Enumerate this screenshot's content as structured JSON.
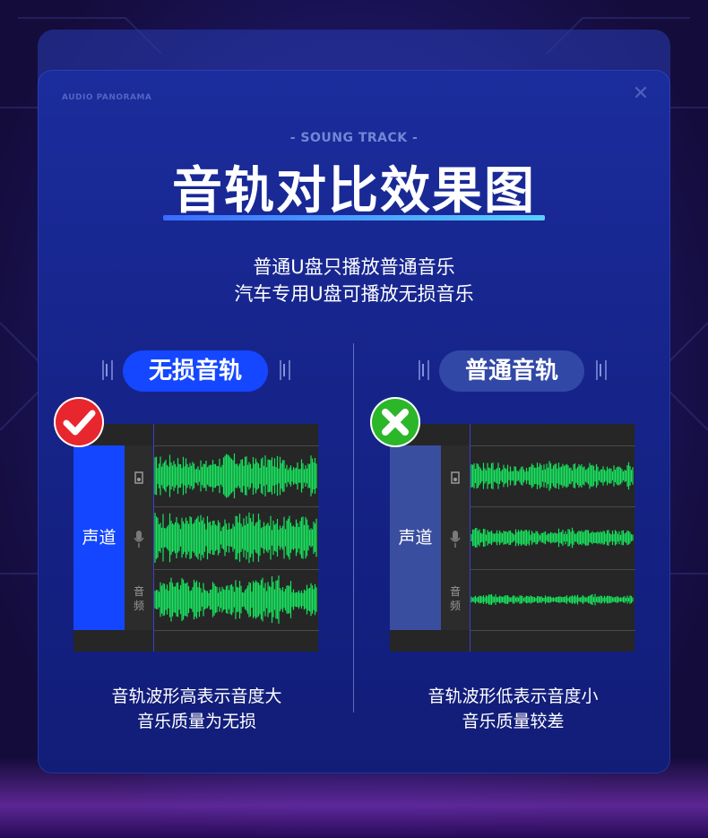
{
  "header": {
    "brand": "AUDIO PANORAMA",
    "subtitle": "- SOUNG TRACK -",
    "title": "音轨对比效果图",
    "desc_line1": "普通U盘只播放普通音乐",
    "desc_line2": "汽车专用U盘可播放无损音乐"
  },
  "colors": {
    "accent_blue": "#1447ff",
    "navy": "#3148a7",
    "wave_green": "#19e35e",
    "check_red": "#e8262e",
    "cross_green": "#2cb62a"
  },
  "left": {
    "pill": "无损音轨",
    "badge_icon": "check-icon",
    "track_label": "声道",
    "icon_audio_text": "音频",
    "caption_line1": "音轨波形高表示音度大",
    "caption_line2": "音乐质量为无损",
    "amplitudes": [
      0.85,
      0.95,
      0.88
    ]
  },
  "right": {
    "pill": "普通音轨",
    "badge_icon": "cross-icon",
    "track_label": "声道",
    "icon_audio_text": "音频",
    "caption_line1": "音轨波形低表示音度小",
    "caption_line2": "音乐质量较差",
    "amplitudes": [
      0.55,
      0.35,
      0.2
    ]
  }
}
